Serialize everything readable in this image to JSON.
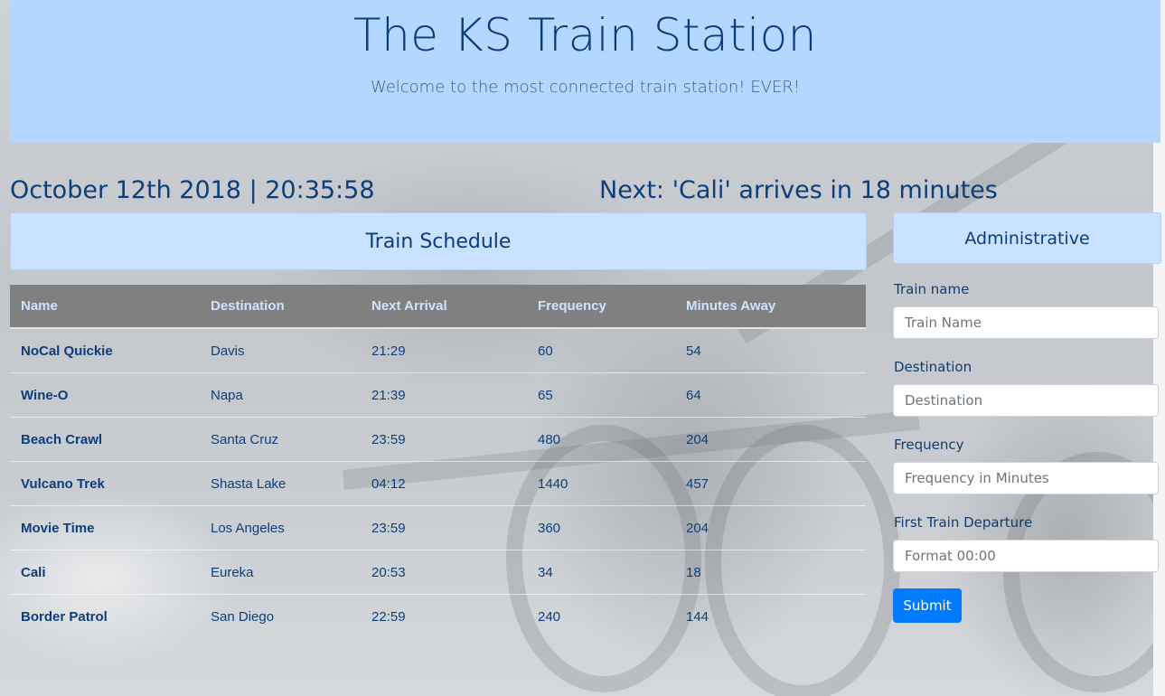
{
  "header": {
    "title": "The KS Train Station",
    "subtitle": "Welcome to the most connected train station! EVER!"
  },
  "status": {
    "datetime": "October 12th 2018 | 20:35:58",
    "next_train": "Next: 'Cali' arrives in 18 minutes"
  },
  "schedule": {
    "title": "Train Schedule",
    "columns": [
      "Name",
      "Destination",
      "Next Arrival",
      "Frequency",
      "Minutes Away"
    ],
    "rows": [
      {
        "name": "NoCal Quickie",
        "destination": "Davis",
        "next_arrival": "21:29",
        "frequency": "60",
        "minutes_away": "54"
      },
      {
        "name": "Wine-O",
        "destination": "Napa",
        "next_arrival": "21:39",
        "frequency": "65",
        "minutes_away": "64"
      },
      {
        "name": "Beach Crawl",
        "destination": "Santa Cruz",
        "next_arrival": "23:59",
        "frequency": "480",
        "minutes_away": "204"
      },
      {
        "name": "Vulcano Trek",
        "destination": "Shasta Lake",
        "next_arrival": "04:12",
        "frequency": "1440",
        "minutes_away": "457"
      },
      {
        "name": "Movie Time",
        "destination": "Los Angeles",
        "next_arrival": "23:59",
        "frequency": "360",
        "minutes_away": "204"
      },
      {
        "name": "Cali",
        "destination": "Eureka",
        "next_arrival": "20:53",
        "frequency": "34",
        "minutes_away": "18"
      },
      {
        "name": "Border Patrol",
        "destination": "San Diego",
        "next_arrival": "22:59",
        "frequency": "240",
        "minutes_away": "144"
      }
    ]
  },
  "admin": {
    "title": "Administrative",
    "fields": [
      {
        "label": "Train name",
        "placeholder": "Train Name",
        "value": ""
      },
      {
        "label": "Destination",
        "placeholder": "Destination",
        "value": ""
      },
      {
        "label": "Frequency",
        "placeholder": "Frequency in Minutes",
        "value": ""
      },
      {
        "label": "First Train Departure",
        "placeholder": "Format 00:00",
        "value": ""
      }
    ],
    "submit_label": "Submit"
  },
  "colors": {
    "header_bg": "#b3d7ff",
    "card_bg": "#c9e2ff",
    "text_primary": "#0d3e7c",
    "table_header_bg": "#808080",
    "submit_bg": "#007bff"
  }
}
